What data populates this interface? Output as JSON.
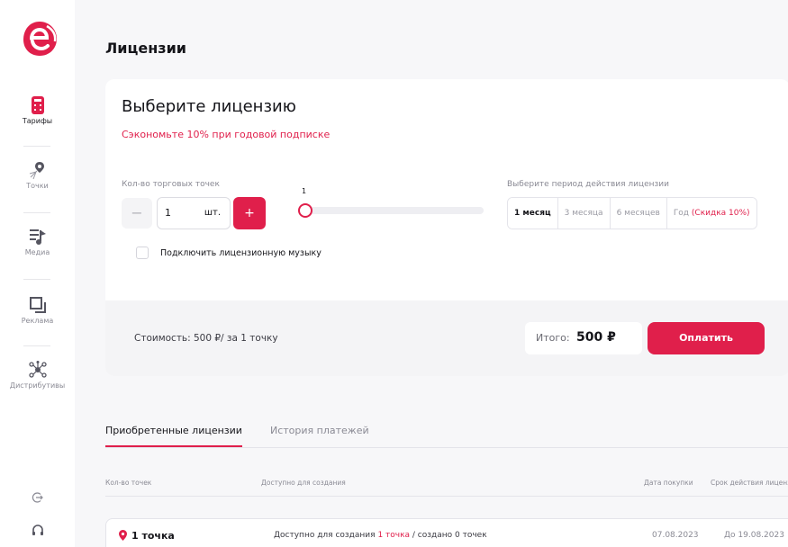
{
  "sidebar": {
    "logo_letter": "e",
    "items": [
      {
        "label": "Тарифы",
        "icon": "calculator-icon"
      },
      {
        "label": "Точки",
        "icon": "map-pin-icon"
      },
      {
        "label": "Медиа",
        "icon": "playlist-icon"
      },
      {
        "label": "Реклама",
        "icon": "ads-icon"
      },
      {
        "label": "Дистрибутивы",
        "icon": "network-icon"
      }
    ],
    "bottom_icons": [
      "logout-icon",
      "headset-icon"
    ]
  },
  "page": {
    "title": "Лицензии"
  },
  "license_card": {
    "title": "Выберите лицензию",
    "promo": "Сэкономьте 10% при годовой подписке",
    "quantity": {
      "label": "Кол-во торговых точек",
      "minus": "−",
      "value": "1",
      "unit": "шт.",
      "plus": "+"
    },
    "slider": {
      "value": "1"
    },
    "period": {
      "label": "Выберите период действия лицензии",
      "options": [
        {
          "label": "1 месяц",
          "active": true
        },
        {
          "label": "3 месяца",
          "active": false
        },
        {
          "label": "6 месяцев",
          "active": false
        },
        {
          "label": "Год ",
          "discount": "(Скидка 10%)",
          "active": false
        }
      ]
    },
    "music_label": "Подключить лицензионную музыку",
    "footer": {
      "cost": "Стоимость: 500 ₽/ за 1 точку",
      "total_label": "Итого:",
      "total_value": "500 ₽",
      "pay_button": "Оплатить"
    }
  },
  "tabs": [
    {
      "label": "Приобретенные лицензии",
      "active": true
    },
    {
      "label": "История платежей",
      "active": false
    }
  ],
  "table": {
    "headers": [
      "Кол-во точек",
      "Доступно для создания",
      "Дата покупки",
      "Срок действия лицензи"
    ],
    "rows": [
      {
        "title": "1 точка",
        "avail_prefix": "Доступно для создания ",
        "avail_highlight": "1 точка",
        "avail_suffix": " / создано 0 точек",
        "purchase_date": "07.08.2023",
        "valid_until": "До 19.08.2023"
      }
    ]
  },
  "colors": {
    "accent": "#e01f4b",
    "background": "#f7f7f9"
  }
}
